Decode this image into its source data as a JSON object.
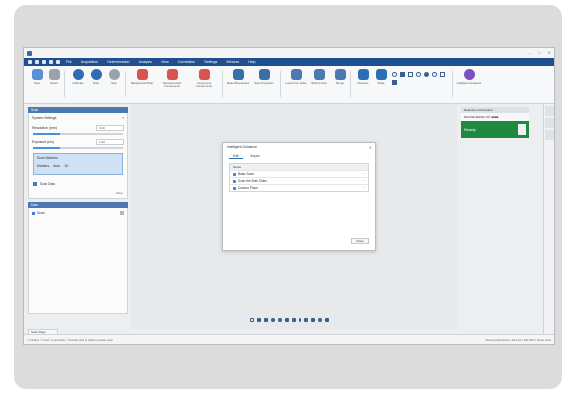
{
  "window": {
    "title": "",
    "controls": [
      "–",
      "□",
      "✕"
    ]
  },
  "menubar": {
    "items": [
      "File",
      "Acquisition",
      "Determination",
      "Analysis",
      "View",
      "Correlation",
      "Settings",
      "Window",
      "Help"
    ]
  },
  "ribbon": {
    "buttons": [
      {
        "label": "New",
        "color": "#5a8fd6",
        "icon": "new-icon"
      },
      {
        "label": "Reset",
        "color": "#9aa3ad",
        "icon": "reset-icon"
      },
      {
        "label": "Calibrate",
        "color": "#2d6fb7",
        "icon": "calibrate-icon"
      },
      {
        "label": "Scan",
        "color": "#2d6fb7",
        "icon": "scan-icon"
      },
      {
        "label": "Stop",
        "color": "#9aa3ad",
        "icon": "stop-icon"
      },
      {
        "label": "Background Plate",
        "color": "#d9534f",
        "icon": "background-icon"
      },
      {
        "label": "Reconstructed Components",
        "color": "#d9534f",
        "icon": "reconstruct-icon"
      },
      {
        "label": "Component Components",
        "color": "#d9534f",
        "icon": "component-icon"
      },
      {
        "label": "Model Boundaries",
        "color": "#3a6ea8",
        "icon": "model-icon"
      },
      {
        "label": "Save Projection",
        "color": "#3a6ea8",
        "icon": "save-icon"
      },
      {
        "label": "Load From Index",
        "color": "#4c78b4",
        "icon": "load-icon"
      },
      {
        "label": "Batch Limits",
        "color": "#4c78b4",
        "icon": "batch-icon"
      },
      {
        "label": "Merge",
        "color": "#4c78b4",
        "icon": "merge-icon"
      },
      {
        "label": "Distance",
        "color": "#2d6fb7",
        "icon": "distance-icon"
      },
      {
        "label": "Scale",
        "color": "#2d6fb7",
        "icon": "scale-icon"
      },
      {
        "label": "Intelligent Guidance",
        "color": "#7b4fbf",
        "icon": "guidance-icon"
      }
    ]
  },
  "left_panel": {
    "scan_header": "Scan",
    "system_settings": "System Settings",
    "resolution_label": "Resolution (mm)",
    "resolution_value": "0.40",
    "exposure_label": "Exposure (ms)",
    "exposure_value": "1.00",
    "scan_markers": "Scan Markers",
    "markers_sub": "Markers",
    "markers_mode": "Auto",
    "markers_count": "10",
    "scan_data": "Scan Data",
    "more": "More",
    "data_header": "Data",
    "data_item": "Scan",
    "footer_tab": "Scan Page"
  },
  "dialog": {
    "title": "Intelligent Guidance",
    "close_x": "✕",
    "tabs": [
      "Edit",
      "Import"
    ],
    "list_header": "Name",
    "items": [
      "Basic Scan",
      "Scan the Both Sides",
      "Custom Place"
    ],
    "close_button": "Close"
  },
  "right_panel": {
    "header": "Real-time Information",
    "device": "DEVICE/SERIAL NO: ■■■■",
    "status": "Ready"
  },
  "statusbar": {
    "left": "☐ Outline  ☐ Grid  ☐ Landmark  ☐  Double click to add/to position scan",
    "right": "Working Resolution  |  Add Iris  |  100.00%  |  Reset View"
  }
}
